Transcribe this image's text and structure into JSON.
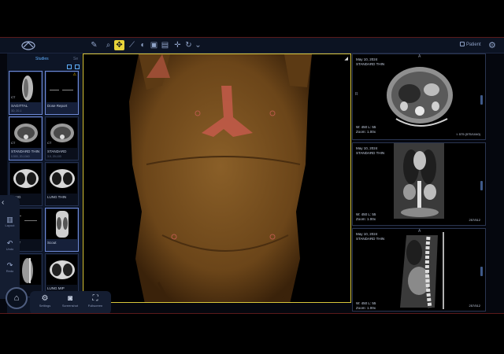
{
  "toolbar": {
    "patient_label": "Patient",
    "tools": [
      "pencil-icon",
      "search-icon",
      "move-icon",
      "contrast-icon",
      "window-icon",
      "camera-icon",
      "ruler-icon",
      "crosshair-icon",
      "rotate-icon",
      "more-icon"
    ]
  },
  "studies": {
    "tab_studies": "Studies",
    "tab_other": "Se",
    "items": [
      {
        "name": "SAGITTAL",
        "sub": "3D, 20-1",
        "tag": "CT"
      },
      {
        "name": "Dose Report",
        "sub": "",
        "tag": "",
        "warn": "⚠"
      },
      {
        "name": "STANDARD THIN",
        "sub": "0.500, 20-1040",
        "tag": "CT"
      },
      {
        "name": "STANDARD",
        "sub": "3.0, 20-103",
        "tag": "CT"
      },
      {
        "name": "LUNG",
        "sub": "",
        "tag": ""
      },
      {
        "name": "LUNG THIN",
        "sub": "",
        "tag": ""
      },
      {
        "name": "RENT",
        "sub": "",
        "tag": ""
      },
      {
        "name": "Scout",
        "sub": "",
        "tag": ""
      },
      {
        "name": "",
        "sub": "",
        "tag": ""
      },
      {
        "name": "LUNG MIP",
        "sub": "",
        "tag": ""
      }
    ]
  },
  "rail": {
    "layout_label": "Layout",
    "undo_label": "Undo",
    "redo_label": "Redo"
  },
  "dock": {
    "settings_label": "Settings",
    "screenshot_label": "Screenshot",
    "fullscreen_label": "Fullscreen"
  },
  "viewers": {
    "axial": {
      "date": "May 10, 2024",
      "series": "STANDARD THIN",
      "wl": "W: 450  L: 55",
      "zoom": "Zoom: 1.00x",
      "slice": "I: 575 (575/1040)",
      "marker_top": "A",
      "marker_left": "R"
    },
    "coronal": {
      "date": "May 10, 2024",
      "series": "STANDARD THIN",
      "wl": "W: 450  L: 55",
      "zoom": "Zoom: 1.00x",
      "slice": "257/512"
    },
    "sagittal": {
      "date": "May 10, 2024",
      "series": "STANDARD THIN",
      "wl": "W: 450  L: 55",
      "zoom": "Zoom: 1.00x",
      "slice": "257/512",
      "marker_top": "A"
    }
  }
}
